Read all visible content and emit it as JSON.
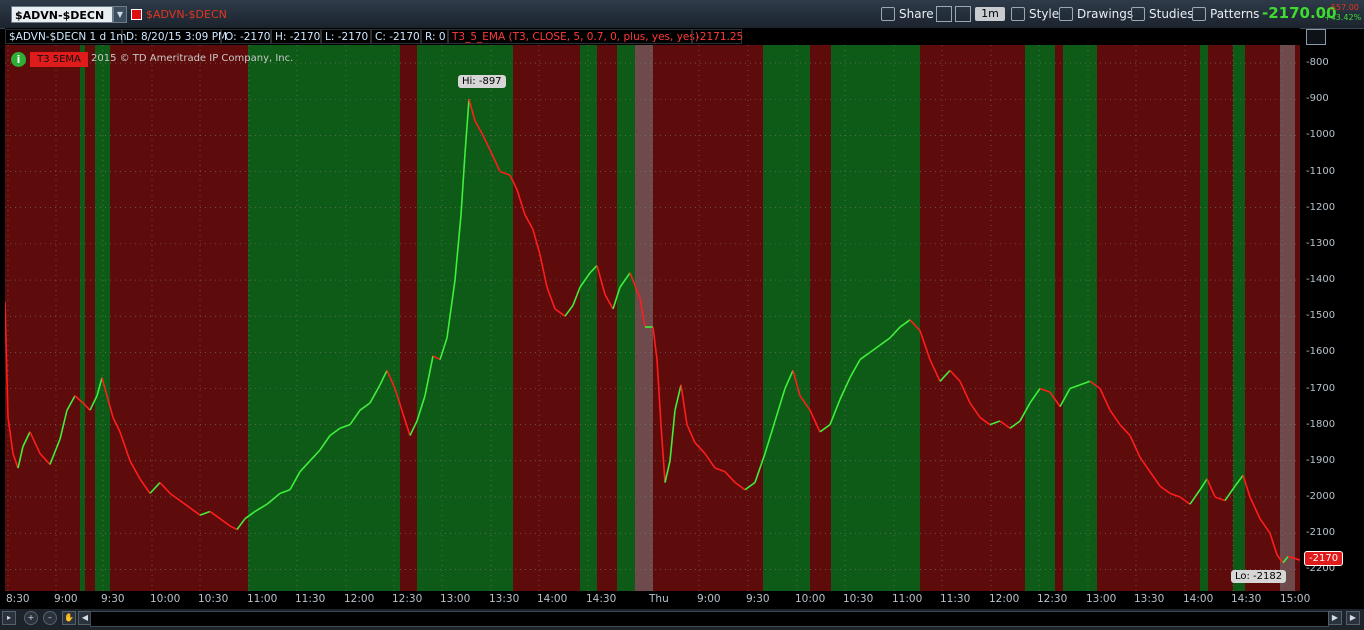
{
  "toolbar": {
    "symbol": "$ADVN-$DECN",
    "description": "$ADVN-$DECN",
    "share_label": "Share",
    "aggregation": "1m",
    "style_label": "Style",
    "drawings_label": "Drawings",
    "studies_label": "Studies",
    "patterns_label": "Patterns",
    "last_price": "-2170.00",
    "net_change": "-557.00",
    "pct_change": "+43.42%"
  },
  "info_bar": {
    "symbol_period": "$ADVN-$DECN 1 d 1m",
    "date": "D: 8/20/15 3:09 PM",
    "open": "O: -2170",
    "high": "H: -2170",
    "low": "L: -2170",
    "close": "C: -2170",
    "range": "R: 0",
    "study": "T3_5_EMA (T3, CLOSE, 5, 0.7, 0, plus, yes, yes)",
    "study_value": "-2171.25"
  },
  "chart_overlay": {
    "info_icon": "i",
    "study_badge": "T3 5EMA",
    "copyright": "2015 © TD Ameritrade IP Company, Inc.",
    "hi_label": "Hi: -897",
    "lo_label": "Lo: -2182",
    "last_tag": "-2170"
  },
  "colors": {
    "up_line": "#3ef03a",
    "down_line": "#ff1d1d",
    "up_zone": "#0e5a17",
    "down_zone": "#5e0b0b",
    "neutral_zone": "#6e4a4d"
  },
  "chart_data": {
    "type": "line",
    "ylim": [
      -2260,
      -750
    ],
    "y_ticks": [
      "-800",
      "-900",
      "-1000",
      "-1100",
      "-1200",
      "-1300",
      "-1400",
      "-1500",
      "-1600",
      "-1700",
      "-1800",
      "-1900",
      "-2000",
      "-2100",
      "-2200"
    ],
    "x_ticks": [
      "8:30",
      "9:00",
      "9:30",
      "10:00",
      "10:30",
      "11:00",
      "11:30",
      "12:00",
      "12:30",
      "13:00",
      "13:30",
      "14:00",
      "14:30",
      "Thu",
      "9:00",
      "9:30",
      "10:00",
      "10:30",
      "11:00",
      "11:30",
      "12:00",
      "12:30",
      "13:00",
      "13:30",
      "14:00",
      "14:30",
      "15:00"
    ],
    "zones": [
      {
        "start": 0,
        "end": 75,
        "kind": "down"
      },
      {
        "start": 75,
        "end": 80,
        "kind": "up"
      },
      {
        "start": 80,
        "end": 90,
        "kind": "down"
      },
      {
        "start": 90,
        "end": 105,
        "kind": "up"
      },
      {
        "start": 105,
        "end": 243,
        "kind": "down"
      },
      {
        "start": 243,
        "end": 395,
        "kind": "up"
      },
      {
        "start": 395,
        "end": 412,
        "kind": "down"
      },
      {
        "start": 412,
        "end": 508,
        "kind": "up"
      },
      {
        "start": 508,
        "end": 575,
        "kind": "down"
      },
      {
        "start": 575,
        "end": 592,
        "kind": "up"
      },
      {
        "start": 592,
        "end": 612,
        "kind": "down"
      },
      {
        "start": 612,
        "end": 630,
        "kind": "up"
      },
      {
        "start": 630,
        "end": 648,
        "kind": "neutral"
      },
      {
        "start": 648,
        "end": 758,
        "kind": "down"
      },
      {
        "start": 758,
        "end": 805,
        "kind": "up"
      },
      {
        "start": 805,
        "end": 826,
        "kind": "down"
      },
      {
        "start": 826,
        "end": 915,
        "kind": "up"
      },
      {
        "start": 915,
        "end": 1020,
        "kind": "down"
      },
      {
        "start": 1020,
        "end": 1050,
        "kind": "up"
      },
      {
        "start": 1050,
        "end": 1058,
        "kind": "down"
      },
      {
        "start": 1058,
        "end": 1092,
        "kind": "up"
      },
      {
        "start": 1092,
        "end": 1195,
        "kind": "down"
      },
      {
        "start": 1195,
        "end": 1203,
        "kind": "up"
      },
      {
        "start": 1203,
        "end": 1228,
        "kind": "down"
      },
      {
        "start": 1228,
        "end": 1240,
        "kind": "up"
      },
      {
        "start": 1240,
        "end": 1275,
        "kind": "down"
      },
      {
        "start": 1275,
        "end": 1290,
        "kind": "neutral"
      },
      {
        "start": 1290,
        "end": 1295,
        "kind": "down"
      }
    ],
    "series": [
      {
        "values": [
          [
            0,
            -1460
          ],
          [
            3,
            -1780
          ],
          [
            8,
            -1880
          ],
          [
            13,
            -1920
          ],
          [
            18,
            -1860
          ],
          [
            25,
            -1820
          ],
          [
            35,
            -1880
          ],
          [
            45,
            -1910
          ],
          [
            55,
            -1840
          ],
          [
            62,
            -1760
          ],
          [
            70,
            -1720
          ],
          [
            78,
            -1740
          ],
          [
            85,
            -1760
          ],
          [
            92,
            -1720
          ],
          [
            97,
            -1670
          ],
          [
            102,
            -1720
          ],
          [
            108,
            -1780
          ],
          [
            115,
            -1820
          ],
          [
            125,
            -1900
          ],
          [
            135,
            -1950
          ],
          [
            145,
            -1990
          ],
          [
            155,
            -1960
          ],
          [
            165,
            -1990
          ],
          [
            175,
            -2010
          ],
          [
            185,
            -2030
          ],
          [
            195,
            -2050
          ],
          [
            205,
            -2040
          ],
          [
            215,
            -2060
          ],
          [
            225,
            -2080
          ],
          [
            232,
            -2090
          ],
          [
            240,
            -2060
          ],
          [
            250,
            -2040
          ],
          [
            262,
            -2020
          ],
          [
            275,
            -1990
          ],
          [
            285,
            -1980
          ],
          [
            295,
            -1930
          ],
          [
            305,
            -1900
          ],
          [
            315,
            -1870
          ],
          [
            325,
            -1830
          ],
          [
            335,
            -1810
          ],
          [
            345,
            -1800
          ],
          [
            355,
            -1760
          ],
          [
            365,
            -1740
          ],
          [
            375,
            -1690
          ],
          [
            382,
            -1650
          ],
          [
            390,
            -1700
          ],
          [
            398,
            -1770
          ],
          [
            405,
            -1830
          ],
          [
            412,
            -1790
          ],
          [
            420,
            -1720
          ],
          [
            428,
            -1610
          ],
          [
            435,
            -1620
          ],
          [
            442,
            -1560
          ],
          [
            450,
            -1400
          ],
          [
            456,
            -1220
          ],
          [
            460,
            -1050
          ],
          [
            464,
            -900
          ],
          [
            470,
            -960
          ],
          [
            478,
            -1000
          ],
          [
            485,
            -1040
          ],
          [
            495,
            -1100
          ],
          [
            505,
            -1110
          ],
          [
            512,
            -1150
          ],
          [
            520,
            -1220
          ],
          [
            528,
            -1260
          ],
          [
            535,
            -1330
          ],
          [
            542,
            -1420
          ],
          [
            550,
            -1480
          ],
          [
            560,
            -1500
          ],
          [
            568,
            -1470
          ],
          [
            575,
            -1420
          ],
          [
            585,
            -1380
          ],
          [
            592,
            -1360
          ],
          [
            600,
            -1440
          ],
          [
            608,
            -1480
          ],
          [
            615,
            -1420
          ],
          [
            625,
            -1380
          ],
          [
            635,
            -1450
          ],
          [
            640,
            -1530
          ],
          [
            648,
            -1530
          ],
          [
            652,
            -1620
          ],
          [
            656,
            -1800
          ],
          [
            660,
            -1960
          ],
          [
            665,
            -1900
          ],
          [
            670,
            -1760
          ],
          [
            676,
            -1690
          ],
          [
            682,
            -1800
          ],
          [
            690,
            -1850
          ],
          [
            700,
            -1880
          ],
          [
            710,
            -1920
          ],
          [
            720,
            -1930
          ],
          [
            730,
            -1960
          ],
          [
            740,
            -1980
          ],
          [
            750,
            -1960
          ],
          [
            760,
            -1880
          ],
          [
            770,
            -1790
          ],
          [
            780,
            -1700
          ],
          [
            788,
            -1650
          ],
          [
            795,
            -1720
          ],
          [
            805,
            -1760
          ],
          [
            815,
            -1820
          ],
          [
            825,
            -1800
          ],
          [
            835,
            -1730
          ],
          [
            845,
            -1670
          ],
          [
            855,
            -1620
          ],
          [
            865,
            -1600
          ],
          [
            875,
            -1580
          ],
          [
            885,
            -1560
          ],
          [
            895,
            -1530
          ],
          [
            905,
            -1510
          ],
          [
            915,
            -1540
          ],
          [
            925,
            -1620
          ],
          [
            935,
            -1680
          ],
          [
            945,
            -1650
          ],
          [
            955,
            -1680
          ],
          [
            965,
            -1740
          ],
          [
            975,
            -1780
          ],
          [
            985,
            -1800
          ],
          [
            995,
            -1790
          ],
          [
            1005,
            -1810
          ],
          [
            1015,
            -1790
          ],
          [
            1025,
            -1740
          ],
          [
            1035,
            -1700
          ],
          [
            1045,
            -1710
          ],
          [
            1055,
            -1750
          ],
          [
            1065,
            -1700
          ],
          [
            1075,
            -1690
          ],
          [
            1085,
            -1680
          ],
          [
            1095,
            -1700
          ],
          [
            1105,
            -1760
          ],
          [
            1115,
            -1800
          ],
          [
            1125,
            -1830
          ],
          [
            1135,
            -1890
          ],
          [
            1145,
            -1930
          ],
          [
            1155,
            -1970
          ],
          [
            1165,
            -1990
          ],
          [
            1175,
            -2000
          ],
          [
            1185,
            -2020
          ],
          [
            1195,
            -1980
          ],
          [
            1202,
            -1950
          ],
          [
            1210,
            -2000
          ],
          [
            1220,
            -2010
          ],
          [
            1230,
            -1970
          ],
          [
            1238,
            -1940
          ],
          [
            1245,
            -2000
          ],
          [
            1255,
            -2060
          ],
          [
            1265,
            -2100
          ],
          [
            1272,
            -2160
          ],
          [
            1278,
            -2182
          ],
          [
            1283,
            -2165
          ],
          [
            1290,
            -2170
          ],
          [
            1295,
            -2175
          ]
        ]
      }
    ]
  }
}
